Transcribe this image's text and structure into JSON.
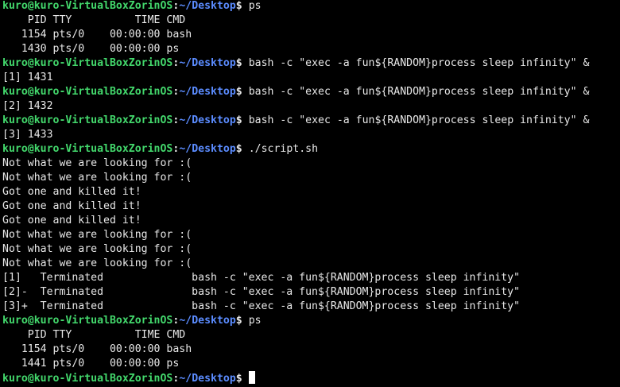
{
  "prompt": {
    "user_host": "kuro@kuro-VirtualBoxZorinOS",
    "colon": ":",
    "path": "~/Desktop",
    "dollar": "$ "
  },
  "colors": {
    "background": "#000000",
    "text": "#e8e8e8",
    "user_host": "#43d86c",
    "path": "#5b8cff",
    "cursor": "#ffffff"
  },
  "lines": [
    {
      "type": "prompt",
      "cmd": "ps"
    },
    {
      "type": "output",
      "text": "    PID TTY          TIME CMD"
    },
    {
      "type": "output",
      "text": "   1154 pts/0    00:00:00 bash"
    },
    {
      "type": "output",
      "text": "   1430 pts/0    00:00:00 ps"
    },
    {
      "type": "prompt",
      "cmd": "bash -c \"exec -a fun${RANDOM}process sleep infinity\" &"
    },
    {
      "type": "output",
      "text": "[1] 1431"
    },
    {
      "type": "prompt",
      "cmd": "bash -c \"exec -a fun${RANDOM}process sleep infinity\" &"
    },
    {
      "type": "output",
      "text": "[2] 1432"
    },
    {
      "type": "prompt",
      "cmd": "bash -c \"exec -a fun${RANDOM}process sleep infinity\" &"
    },
    {
      "type": "output",
      "text": "[3] 1433"
    },
    {
      "type": "prompt",
      "cmd": "./script.sh"
    },
    {
      "type": "output",
      "text": "Not what we are looking for :("
    },
    {
      "type": "output",
      "text": "Not what we are looking for :("
    },
    {
      "type": "output",
      "text": "Got one and killed it!"
    },
    {
      "type": "output",
      "text": "Got one and killed it!"
    },
    {
      "type": "output",
      "text": "Got one and killed it!"
    },
    {
      "type": "output",
      "text": "Not what we are looking for :("
    },
    {
      "type": "output",
      "text": "Not what we are looking for :("
    },
    {
      "type": "output",
      "text": "Not what we are looking for :("
    },
    {
      "type": "output",
      "text": "[1]   Terminated              bash -c \"exec -a fun${RANDOM}process sleep infinity\""
    },
    {
      "type": "output",
      "text": "[2]-  Terminated              bash -c \"exec -a fun${RANDOM}process sleep infinity\""
    },
    {
      "type": "output",
      "text": "[3]+  Terminated              bash -c \"exec -a fun${RANDOM}process sleep infinity\""
    },
    {
      "type": "prompt",
      "cmd": "ps"
    },
    {
      "type": "output",
      "text": "    PID TTY          TIME CMD"
    },
    {
      "type": "output",
      "text": "   1154 pts/0    00:00:00 bash"
    },
    {
      "type": "output",
      "text": "   1441 pts/0    00:00:00 ps"
    },
    {
      "type": "prompt",
      "cmd": "",
      "cursor": true
    }
  ]
}
